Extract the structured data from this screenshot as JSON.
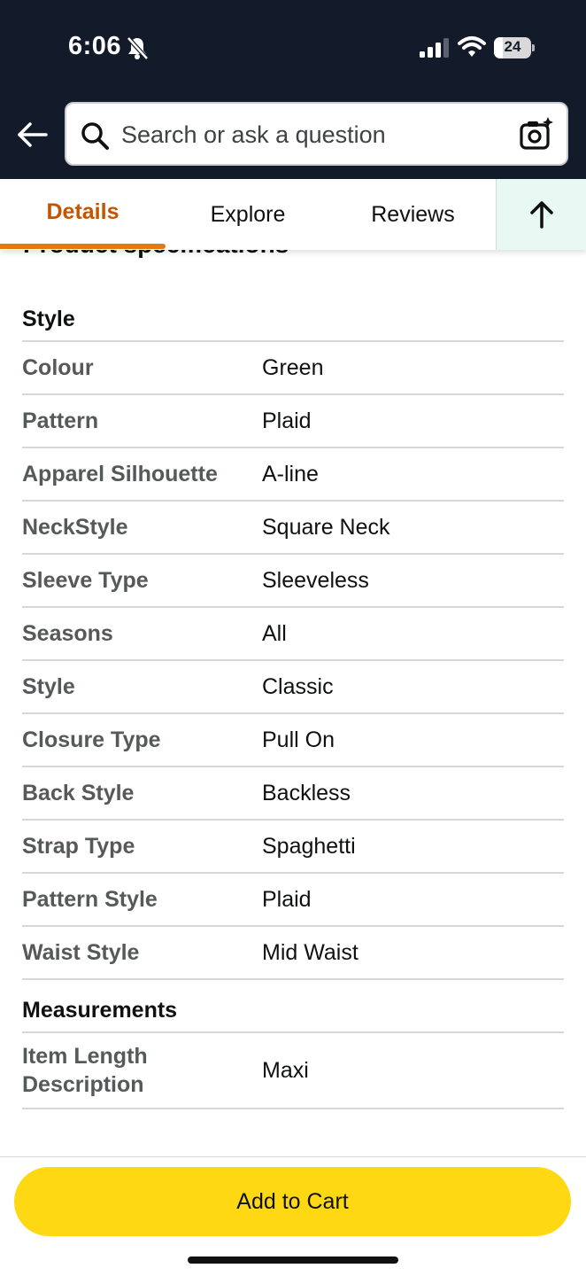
{
  "status_bar": {
    "time": "6:06",
    "battery": "24",
    "battery_level_percent": 24
  },
  "header": {
    "search_placeholder": "Search or ask a question"
  },
  "tabs": [
    {
      "label": "Details",
      "active": true
    },
    {
      "label": "Explore",
      "active": false
    },
    {
      "label": "Reviews",
      "active": false
    }
  ],
  "partial_heading": "Product specifications",
  "sections": [
    {
      "title": "Style",
      "rows": [
        {
          "name": "Colour",
          "value": "Green"
        },
        {
          "name": "Pattern",
          "value": "Plaid"
        },
        {
          "name": "Apparel Silhouette",
          "value": "A-line"
        },
        {
          "name": "NeckStyle",
          "value": "Square Neck"
        },
        {
          "name": "Sleeve Type",
          "value": "Sleeveless"
        },
        {
          "name": "Seasons",
          "value": "All"
        },
        {
          "name": "Style",
          "value": "Classic"
        },
        {
          "name": "Closure Type",
          "value": "Pull On"
        },
        {
          "name": "Back Style",
          "value": "Backless"
        },
        {
          "name": "Strap Type",
          "value": "Spaghetti"
        },
        {
          "name": "Pattern Style",
          "value": "Plaid"
        },
        {
          "name": "Waist Style",
          "value": "Mid Waist"
        }
      ]
    },
    {
      "title": "Measurements",
      "rows": [
        {
          "name": "Item Length Description",
          "value": "Maxi"
        }
      ]
    }
  ],
  "cart": {
    "label": "Add to Cart"
  },
  "colors": {
    "header_bg": "#131a2a",
    "active_tab": "#c45500",
    "tab_underline": "#e47911",
    "cart_button": "#ffd814",
    "up_button_bg": "#e8f8f3"
  },
  "icons": [
    "bell-slash-icon",
    "signal-icon",
    "wifi-icon",
    "battery-icon",
    "back-arrow-icon",
    "search-icon",
    "camera-search-icon",
    "arrow-up-icon"
  ]
}
